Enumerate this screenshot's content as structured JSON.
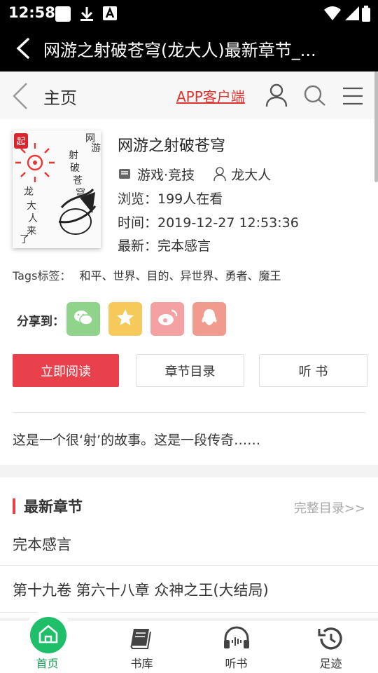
{
  "status": {
    "time": "12:58"
  },
  "titlebar": {
    "title": "网游之射破苍穹(龙大人)最新章节_..."
  },
  "site_header": {
    "home_label": "主页",
    "app_label": "APP客户端"
  },
  "book": {
    "title": "网游之射破苍穹",
    "category": "游戏·竞技",
    "author": "龙大人",
    "views": "浏览：199人在看",
    "time": "时间：2019-12-27 12:53:36",
    "latest": "最新：完本感言",
    "tags_label": "Tags标签：",
    "tags": "和平、世界、目的、异世界、勇者、魔王",
    "share_label": "分享到：",
    "cover_text": [
      "网",
      "游",
      "射",
      "破",
      "苍",
      "穹",
      "龙",
      "大",
      "人",
      "来",
      "了"
    ]
  },
  "buttons": {
    "read": "立即阅读",
    "toc": "章节目录",
    "listen": "听 书"
  },
  "intro": "这是一个很‘射’的故事。这是一段传奇……",
  "latest_chapters": {
    "heading": "最新章节",
    "more": "完整目录>>",
    "items": [
      "完本感言",
      "第十九卷 第六十八章 众神之王(大结局)"
    ]
  },
  "tabbar": {
    "items": [
      {
        "label": "首页"
      },
      {
        "label": "书库"
      },
      {
        "label": "听书"
      },
      {
        "label": "足迹"
      }
    ]
  },
  "colors": {
    "accent": "#e8414b",
    "link_red": "#e0322e",
    "active_green": "#1fbf6a"
  }
}
